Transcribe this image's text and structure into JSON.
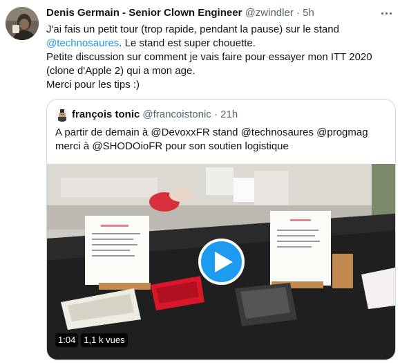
{
  "tweet": {
    "author_name": "Denis Germain - Senior Clown Engineer",
    "author_handle": "@zwindler",
    "separator": "·",
    "time": "5h",
    "more_icon": "more-horizontal-icon",
    "text": {
      "line1": "J'ai fais un petit tour (trop rapide, pendant la pause) sur le stand",
      "mention": "@technosaures",
      "line2_rest": ". Le stand est super chouette.",
      "line3": "Petite discussion sur comment je vais faire pour essayer mon ITT 2020",
      "line4": "(clone d'Apple 2) qui a mon age.",
      "line5": "Merci pour les tips :)"
    }
  },
  "quote": {
    "author_name": "françois tonic",
    "author_handle": "@francoistonic",
    "separator": "·",
    "time": "21h",
    "text": {
      "line1": "A partir de demain à @DevoxxFR stand @technosaures @progmag",
      "line2": "merci à @SHODOioFR pour son soutien logistique"
    },
    "video": {
      "duration": "1:04",
      "views": "1,1 k vues",
      "play_icon": "play-icon",
      "accent": "#1d9bf0"
    }
  },
  "colors": {
    "text_primary": "#0f1419",
    "text_secondary": "#536471",
    "link": "#1d9bf0",
    "border": "#cfd9de"
  }
}
